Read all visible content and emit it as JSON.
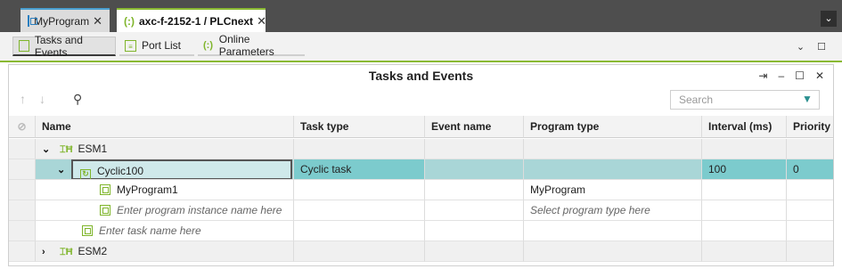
{
  "doc_tabs": [
    {
      "label": "MyProgram",
      "close": "✕"
    },
    {
      "label": "axc-f-2152-1 / PLCnext",
      "close": "✕"
    }
  ],
  "sub_tabs": [
    {
      "label": "Tasks and Events"
    },
    {
      "label": "Port List"
    },
    {
      "label": "Online Parameters"
    }
  ],
  "panel": {
    "title": "Tasks and Events",
    "search_placeholder": "Search"
  },
  "columns": {
    "name": "Name",
    "task_type": "Task type",
    "event_name": "Event name",
    "program_type": "Program type",
    "interval": "Interval (ms)",
    "priority": "Priority"
  },
  "rows": {
    "esm1": {
      "name": "ESM1"
    },
    "cyclic": {
      "name": "Cyclic100",
      "task_type": "Cyclic task",
      "interval": "100",
      "priority": "0"
    },
    "myprogram1": {
      "name": "MyProgram1",
      "program_type": "MyProgram"
    },
    "new_instance": {
      "name": "Enter program instance name here",
      "program_type": "Select program type here"
    },
    "new_task": {
      "name": "Enter task name here"
    },
    "esm2": {
      "name": "ESM2"
    }
  },
  "colors": {
    "accent_green": "#8ab933",
    "selection_teal": "#7ccbcd",
    "selection_light": "#a9d6d7"
  }
}
